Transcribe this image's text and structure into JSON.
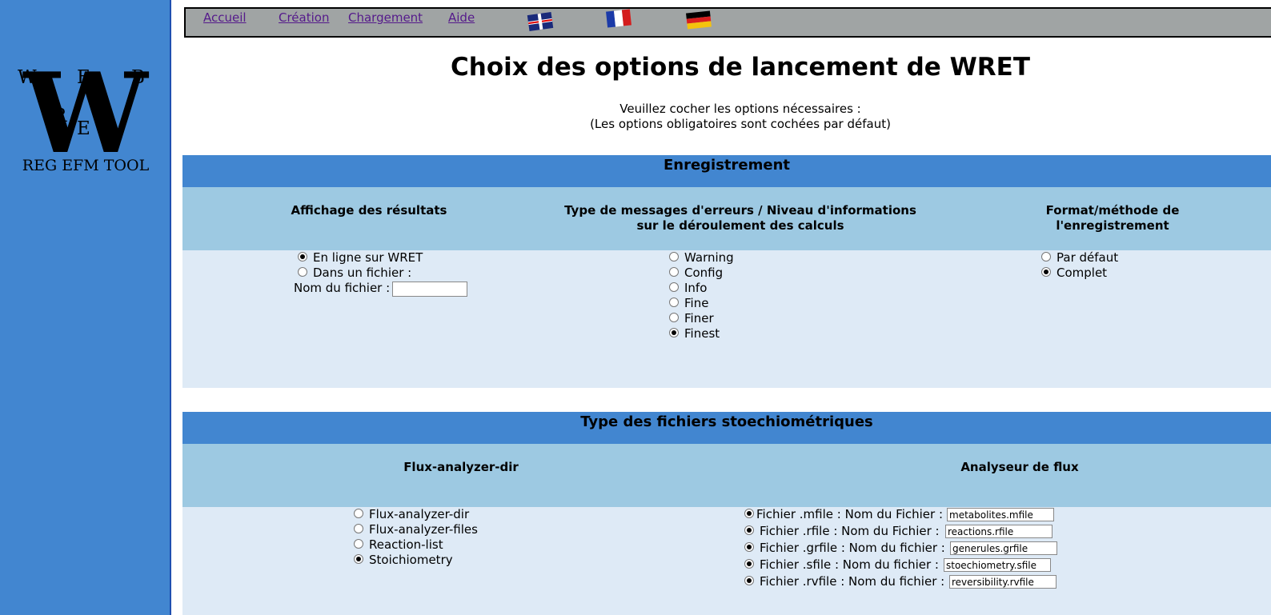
{
  "logo": {
    "letters_top": [
      "W",
      "E",
      "B"
    ],
    "letters_inner": [
      "R",
      "E",
      "T"
    ],
    "big_letter": "W",
    "footer": "REG EFM TOOL"
  },
  "nav": {
    "items": [
      "Accueil",
      "Création",
      "Chargement",
      "Aide"
    ],
    "flags": [
      "flag-uk",
      "flag-fr",
      "flag-de"
    ]
  },
  "page": {
    "title": "Choix des options de lancement de WRET",
    "instruction_1": "Veuillez cocher les options nécessaires :",
    "instruction_2": "(Les options obligatoires sont cochées par défaut)"
  },
  "enregistrement": {
    "header": "Enregistrement",
    "col1_header": "Affichage des résultats",
    "col2_header": "Type de messages d'erreurs / Niveau d'informations sur le déroulement des calculs",
    "col3_header": "Format/méthode de l'enregistrement",
    "affichage_options": [
      {
        "label": "En ligne sur WRET",
        "checked": true
      },
      {
        "label": "Dans un fichier :",
        "checked": false
      }
    ],
    "filename_label": "Nom du fichier :",
    "filename_value": "",
    "messages_options": [
      {
        "label": "Warning",
        "checked": false
      },
      {
        "label": "Config",
        "checked": false
      },
      {
        "label": "Info",
        "checked": false
      },
      {
        "label": "Fine",
        "checked": false
      },
      {
        "label": "Finer",
        "checked": false
      },
      {
        "label": "Finest",
        "checked": true
      }
    ],
    "format_options": [
      {
        "label": "Par défaut",
        "checked": false
      },
      {
        "label": "Complet",
        "checked": true
      }
    ]
  },
  "stoechio": {
    "header": "Type des fichiers stoechiométriques",
    "col1_header": "Flux-analyzer-dir",
    "col2_header": "Analyseur de flux",
    "type_options": [
      {
        "label": "Flux-analyzer-dir",
        "checked": false
      },
      {
        "label": "Flux-analyzer-files",
        "checked": false
      },
      {
        "label": "Reaction-list",
        "checked": false
      },
      {
        "label": "Stoichiometry",
        "checked": true
      }
    ],
    "file_options": [
      {
        "label": "Fichier .mfile : Nom du Fichier :",
        "value": "metabolites.mfile",
        "checked": true
      },
      {
        "label": "Fichier .rfile : Nom du Fichier :",
        "value": "reactions.rfile",
        "checked": true
      },
      {
        "label": "Fichier .grfile : Nom du fichier :",
        "value": "generules.grfile",
        "checked": true
      },
      {
        "label": "Fichier .sfile : Nom du fichier :",
        "value": "stoechiometry.sfile",
        "checked": true
      },
      {
        "label": "Fichier .rvfile : Nom du fichier :",
        "value": "reversibility.rvfile",
        "checked": true
      }
    ]
  },
  "colors": {
    "sidebar": "#4286d0",
    "nav_bg": "#a0a4a4",
    "section_header": "#4286d0",
    "sub_band": "#9dc9e2",
    "body_band": "#deeaf6",
    "link": "#551a8b"
  }
}
